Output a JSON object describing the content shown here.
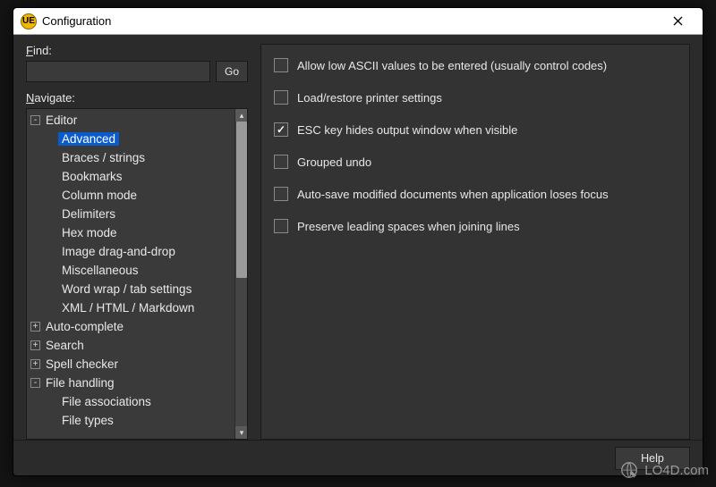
{
  "titlebar": {
    "app_icon_text": "UE",
    "title": "Configuration"
  },
  "left": {
    "find_label": "Find:",
    "go_label": "Go",
    "navigate_label": "Navigate:",
    "tree": [
      {
        "label": "Editor",
        "level": 0,
        "expander": "-",
        "selected": false
      },
      {
        "label": "Advanced",
        "level": 1,
        "expander": "",
        "selected": true
      },
      {
        "label": "Braces / strings",
        "level": 1,
        "expander": "",
        "selected": false
      },
      {
        "label": "Bookmarks",
        "level": 1,
        "expander": "",
        "selected": false
      },
      {
        "label": "Column mode",
        "level": 1,
        "expander": "",
        "selected": false
      },
      {
        "label": "Delimiters",
        "level": 1,
        "expander": "",
        "selected": false
      },
      {
        "label": "Hex mode",
        "level": 1,
        "expander": "",
        "selected": false
      },
      {
        "label": "Image drag-and-drop",
        "level": 1,
        "expander": "",
        "selected": false
      },
      {
        "label": "Miscellaneous",
        "level": 1,
        "expander": "",
        "selected": false
      },
      {
        "label": "Word wrap / tab settings",
        "level": 1,
        "expander": "",
        "selected": false
      },
      {
        "label": "XML / HTML / Markdown",
        "level": 1,
        "expander": "",
        "selected": false
      },
      {
        "label": "Auto-complete",
        "level": 0,
        "expander": "+",
        "selected": false
      },
      {
        "label": "Search",
        "level": 0,
        "expander": "+",
        "selected": false
      },
      {
        "label": "Spell checker",
        "level": 0,
        "expander": "+",
        "selected": false
      },
      {
        "label": "File handling",
        "level": 0,
        "expander": "-",
        "selected": false
      },
      {
        "label": "File associations",
        "level": 1,
        "expander": "",
        "selected": false
      },
      {
        "label": "File types",
        "level": 1,
        "expander": "",
        "selected": false
      }
    ]
  },
  "options": [
    {
      "label": "Allow low ASCII values to be entered (usually control codes)",
      "checked": false
    },
    {
      "label": "Load/restore printer settings",
      "checked": false
    },
    {
      "label": "ESC key hides output window when visible",
      "checked": true
    },
    {
      "label": "Grouped undo",
      "checked": false
    },
    {
      "label": "Auto-save modified documents when application loses focus",
      "checked": false
    },
    {
      "label": "Preserve leading spaces when joining lines",
      "checked": false
    }
  ],
  "footer": {
    "help_label": "Help"
  },
  "watermark": "LO4D.com"
}
